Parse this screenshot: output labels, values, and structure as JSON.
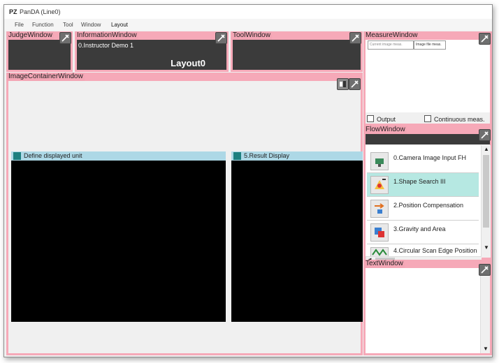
{
  "app": {
    "icon_text": "PZ",
    "title": "PanDA (Line0)"
  },
  "menu": [
    "File",
    "Function",
    "Tool",
    "Window",
    "Layout"
  ],
  "judge_window": {
    "title": "JudgeWindow"
  },
  "information_window": {
    "title": "InformationWindow",
    "scene_text": "0.Instructor Demo 1",
    "layout_text": "Layout0"
  },
  "tool_window": {
    "title": "ToolWindow"
  },
  "measure_window": {
    "title": "MeasureWindow",
    "tab_1": "Current image meas.",
    "tab_2": "Image file meas.",
    "output_label": "Output",
    "continuous_label": "Continuous meas."
  },
  "image_container": {
    "title": "ImageContainerWindow",
    "left_unit_label": "Define displayed unit",
    "right_unit_label": "5.Result Display"
  },
  "flow_window": {
    "title": "FlowWindow",
    "items": [
      {
        "label": "0.Camera Image Input FH",
        "icon": "camera-icon",
        "selected": false
      },
      {
        "label": "1.Shape Search III",
        "icon": "shape-search-icon",
        "selected": true
      },
      {
        "label": "2.Position Compensation",
        "icon": "position-compensation-icon",
        "selected": false
      },
      {
        "label": "3.Gravity and Area",
        "icon": "gravity-area-icon",
        "selected": false
      },
      {
        "label": "4.Circular Scan Edge Position",
        "icon": "circular-scan-icon",
        "selected": false
      }
    ]
  },
  "text_window": {
    "title": "TextWindow"
  },
  "colors": {
    "pane_border": "#f6a9b8",
    "dark_pane": "#3b3b3b",
    "unit_header": "#add8e6",
    "selected_item": "#b6e8e2"
  }
}
